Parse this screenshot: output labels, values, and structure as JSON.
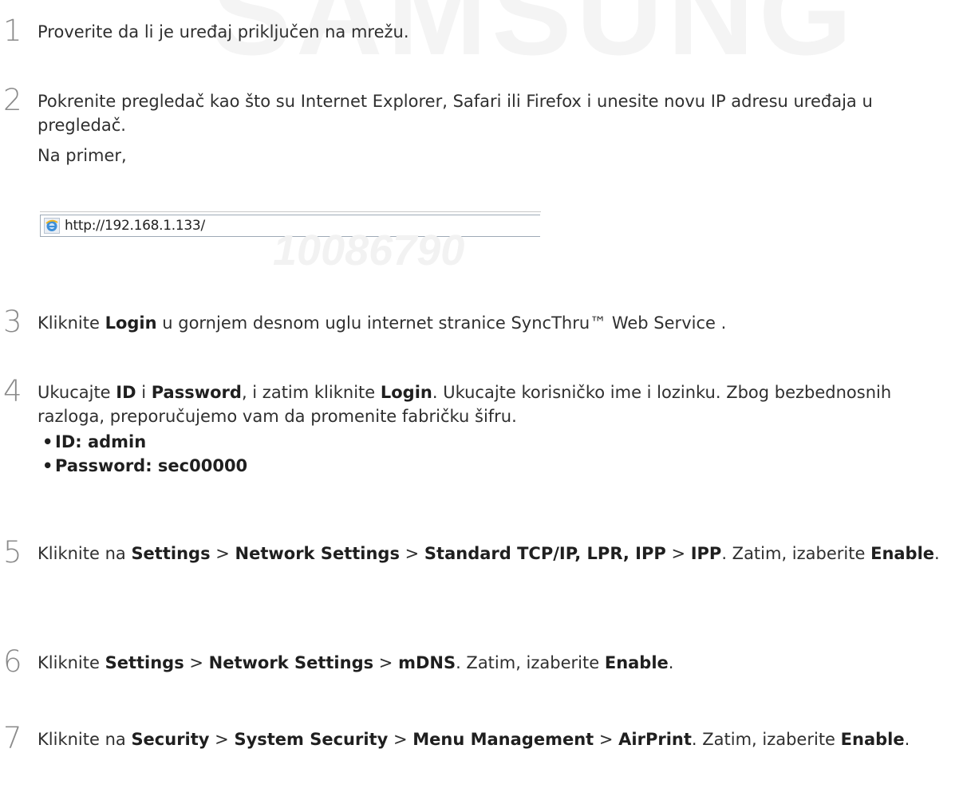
{
  "watermark": "SAMSUNG",
  "steps": [
    {
      "num": "1",
      "text": "Proverite da li je uređaj priključen na mrežu."
    },
    {
      "num": "2",
      "text": "Pokrenite pregledač kao što su Internet Explorer, Safari ili Firefox i unesite novu IP adresu uređaja u pregledač.",
      "example_label": "Na primer,",
      "example_url": "http://192.168.1.133/",
      "example_watermark": "10086790"
    },
    {
      "num": "3",
      "parts": [
        "Kliknite ",
        "Login",
        " u gornjem desnom uglu internet stranice SyncThru™ Web Service ."
      ]
    },
    {
      "num": "4",
      "parts": [
        "Ukucajte ",
        "ID",
        " i ",
        "Password",
        ", i zatim kliknite ",
        "Login",
        ". Ukucajte korisničko ime i lozinku. Zbog bezbednosnih razloga, preporučujemo vam da promenite fabričku šifru."
      ],
      "bullets": [
        "ID: admin",
        "Password: sec00000"
      ]
    },
    {
      "num": "5",
      "parts": [
        "Kliknite na ",
        "Settings",
        " > ",
        "Network Settings",
        " > ",
        "Standard TCP/IP, LPR, IPP",
        " > ",
        "IPP",
        ". Zatim, izaberite ",
        "Enable",
        "."
      ]
    },
    {
      "num": "6",
      "parts": [
        "Kliknite ",
        "Settings",
        " > ",
        "Network Settings",
        " > ",
        "mDNS",
        ". Zatim, izaberite ",
        "Enable",
        "."
      ]
    },
    {
      "num": "7",
      "parts": [
        "Kliknite na ",
        "Security",
        " > ",
        "System Security",
        " > ",
        "Menu Management",
        " > ",
        "AirPrint",
        ". Zatim, izaberite ",
        "Enable",
        "."
      ]
    }
  ]
}
